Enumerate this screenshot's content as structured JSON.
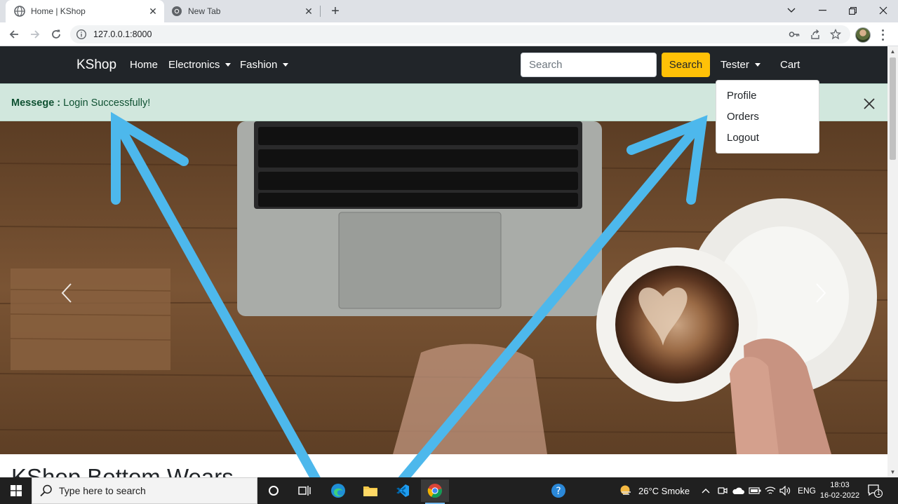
{
  "browser": {
    "tabs": [
      {
        "title": "Home | KShop",
        "active": true
      },
      {
        "title": "New Tab",
        "active": false
      }
    ],
    "url": "127.0.0.1:8000"
  },
  "navbar": {
    "brand": "KShop",
    "links": [
      {
        "label": "Home"
      },
      {
        "label": "Electronics",
        "dropdown": true
      },
      {
        "label": "Fashion",
        "dropdown": true
      }
    ],
    "search": {
      "placeholder": "Search",
      "value": "",
      "button_label": "Search"
    },
    "user": {
      "label": "Tester"
    },
    "cart_label": "Cart",
    "user_menu": [
      "Profile",
      "Orders",
      "Logout"
    ]
  },
  "alert": {
    "label": "Messege :",
    "message": "Login Successfully!"
  },
  "section_title": "KShop Bottom Wears",
  "taskbar": {
    "search_placeholder": "Type here to search",
    "weather": "26°C  Smoke",
    "language": "ENG",
    "time": "18:03",
    "date": "16-02-2022",
    "notification_count": "1"
  },
  "colors": {
    "navbar_bg": "#212529",
    "search_button": "#ffc107",
    "alert_bg": "#d1e7dd",
    "alert_text": "#0f5132",
    "annotation_arrow": "#4db8ec"
  }
}
